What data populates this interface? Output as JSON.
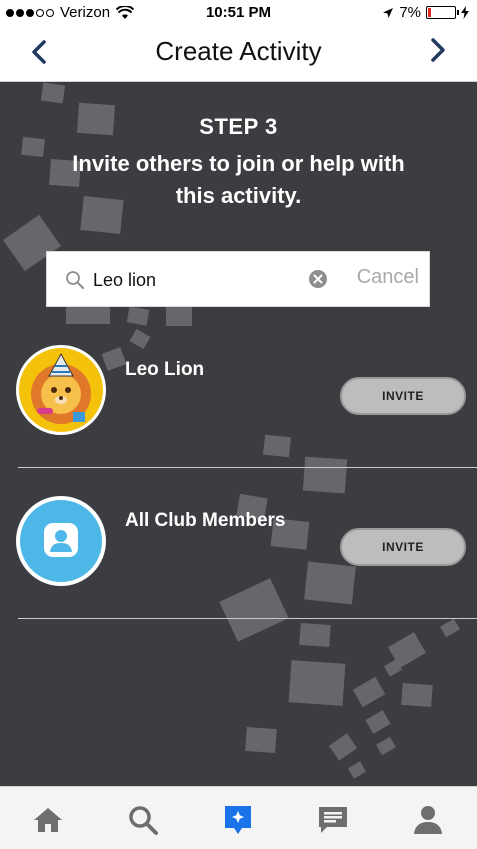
{
  "status": {
    "carrier": "Verizon",
    "time": "10:51 PM",
    "battery": "7%"
  },
  "nav": {
    "title": "Create Activity"
  },
  "step": {
    "heading": "STEP 3",
    "description": "Invite others to join or help with this activity."
  },
  "search": {
    "value": "Leo lion",
    "cancel_label": "Cancel"
  },
  "results": [
    {
      "name": "Leo Lion",
      "action": "INVITE"
    },
    {
      "name": "All Club Members",
      "action": "INVITE"
    }
  ],
  "colors": {
    "background": "#3c3d40",
    "accent": "#1a73e8",
    "club_avatar": "#4db8e8"
  },
  "tabs": [
    {
      "icon": "home-icon"
    },
    {
      "icon": "search-icon"
    },
    {
      "icon": "activity-icon",
      "active": true
    },
    {
      "icon": "messages-icon"
    },
    {
      "icon": "profile-icon"
    }
  ]
}
